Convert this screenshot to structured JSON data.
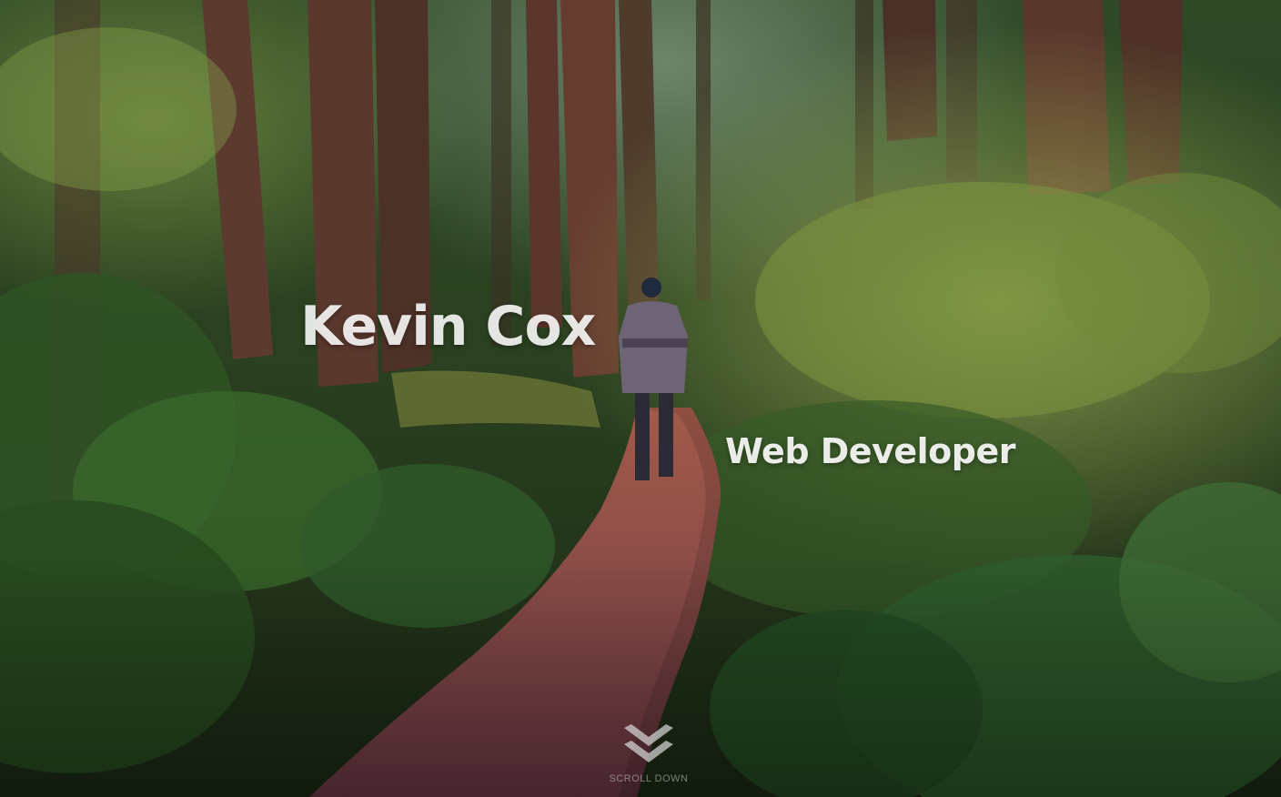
{
  "hero": {
    "name": "Kevin Cox",
    "tagline": "Web Developer",
    "background_description": "forest trail with tall trees, ferns and a person walking on a red boardwalk path",
    "scroll": {
      "label": "SCROLL DOWN",
      "icon": "double-chevron-down-icon"
    }
  },
  "colors": {
    "forest_dark": "#1d2b17",
    "forest_mid": "#3b5a26",
    "foliage_light": "#8ea94a",
    "trunk": "#5a3327",
    "path": "#8a4a3c",
    "text": "#ffffff"
  }
}
